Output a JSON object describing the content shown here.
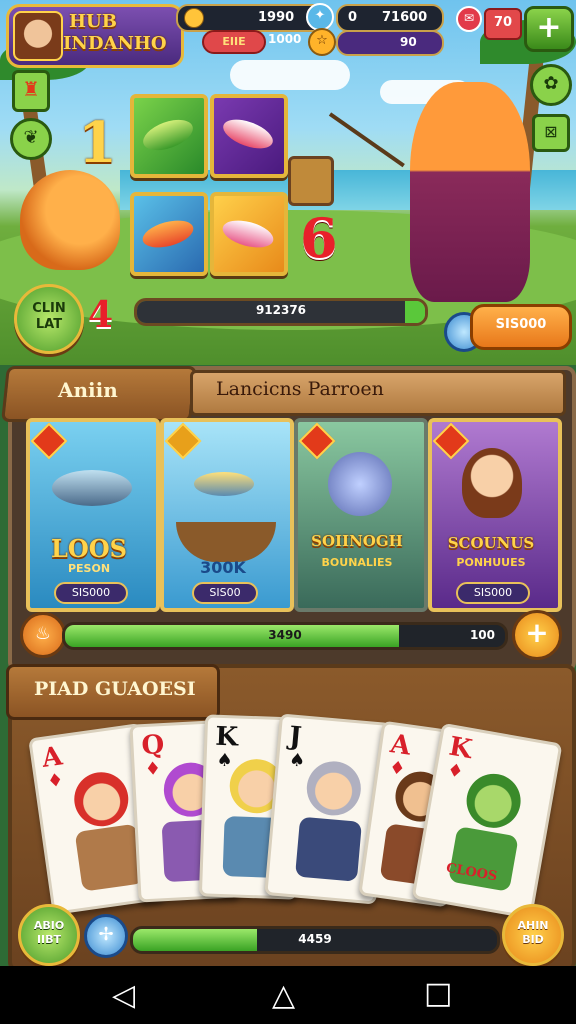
{
  "hud": {
    "title_line1": "HUB",
    "title_line2": "INDANHO",
    "coins_value": "1990",
    "gems_value": "71600",
    "gems_prefix": "0",
    "energy_label": "EIIE",
    "energy_value": "1000",
    "trophies_value": "90",
    "level_badge": "70"
  },
  "scene": {
    "number_left": "1",
    "number_right": "6",
    "number_level": "4",
    "level_button": "CLIN\nLAT",
    "progress_text": "912376",
    "progress_fraction": 0.93,
    "reward_button": "SIS000"
  },
  "mid": {
    "tab_title": "Aniin",
    "header": "Lancicns Parroen",
    "cards": [
      {
        "title": "LOOS",
        "subtitle": "PESON",
        "chip": "SIS000"
      },
      {
        "title": "300K",
        "subtitle": "",
        "chip": "SIS00"
      },
      {
        "title": "SOIINOGH",
        "subtitle": "BOUNALIES",
        "chip": ""
      },
      {
        "title": "SCOUNUS",
        "subtitle": "PONHUUES",
        "chip": "SIS000"
      }
    ],
    "progress_text": "3490",
    "progress_fraction": 0.76,
    "progress_right": "100"
  },
  "bottom": {
    "title": "PIAD GUAOESI",
    "cards": [
      {
        "rank": "A",
        "suit": "♦",
        "color": "red"
      },
      {
        "rank": "Q",
        "suit": "♦",
        "color": "red"
      },
      {
        "rank": "K",
        "suit": "♠",
        "color": "black"
      },
      {
        "rank": "J",
        "suit": "♠",
        "color": "black"
      },
      {
        "rank": "A",
        "suit": "♦",
        "color": "red"
      },
      {
        "rank": "K",
        "suit": "♦",
        "color": "red"
      }
    ],
    "last_card_text": "CLOOS",
    "left_button": "ABIO\nIIBT",
    "progress_text": "4459",
    "progress_fraction": 0.34,
    "right_button": "AHIN\nBID"
  },
  "nav": {
    "back": "◁",
    "home": "△",
    "recent": "□"
  },
  "colors": {
    "accent_gold": "#ffd34a",
    "progress_green": "#3aa324",
    "wood": "#8b5424"
  }
}
